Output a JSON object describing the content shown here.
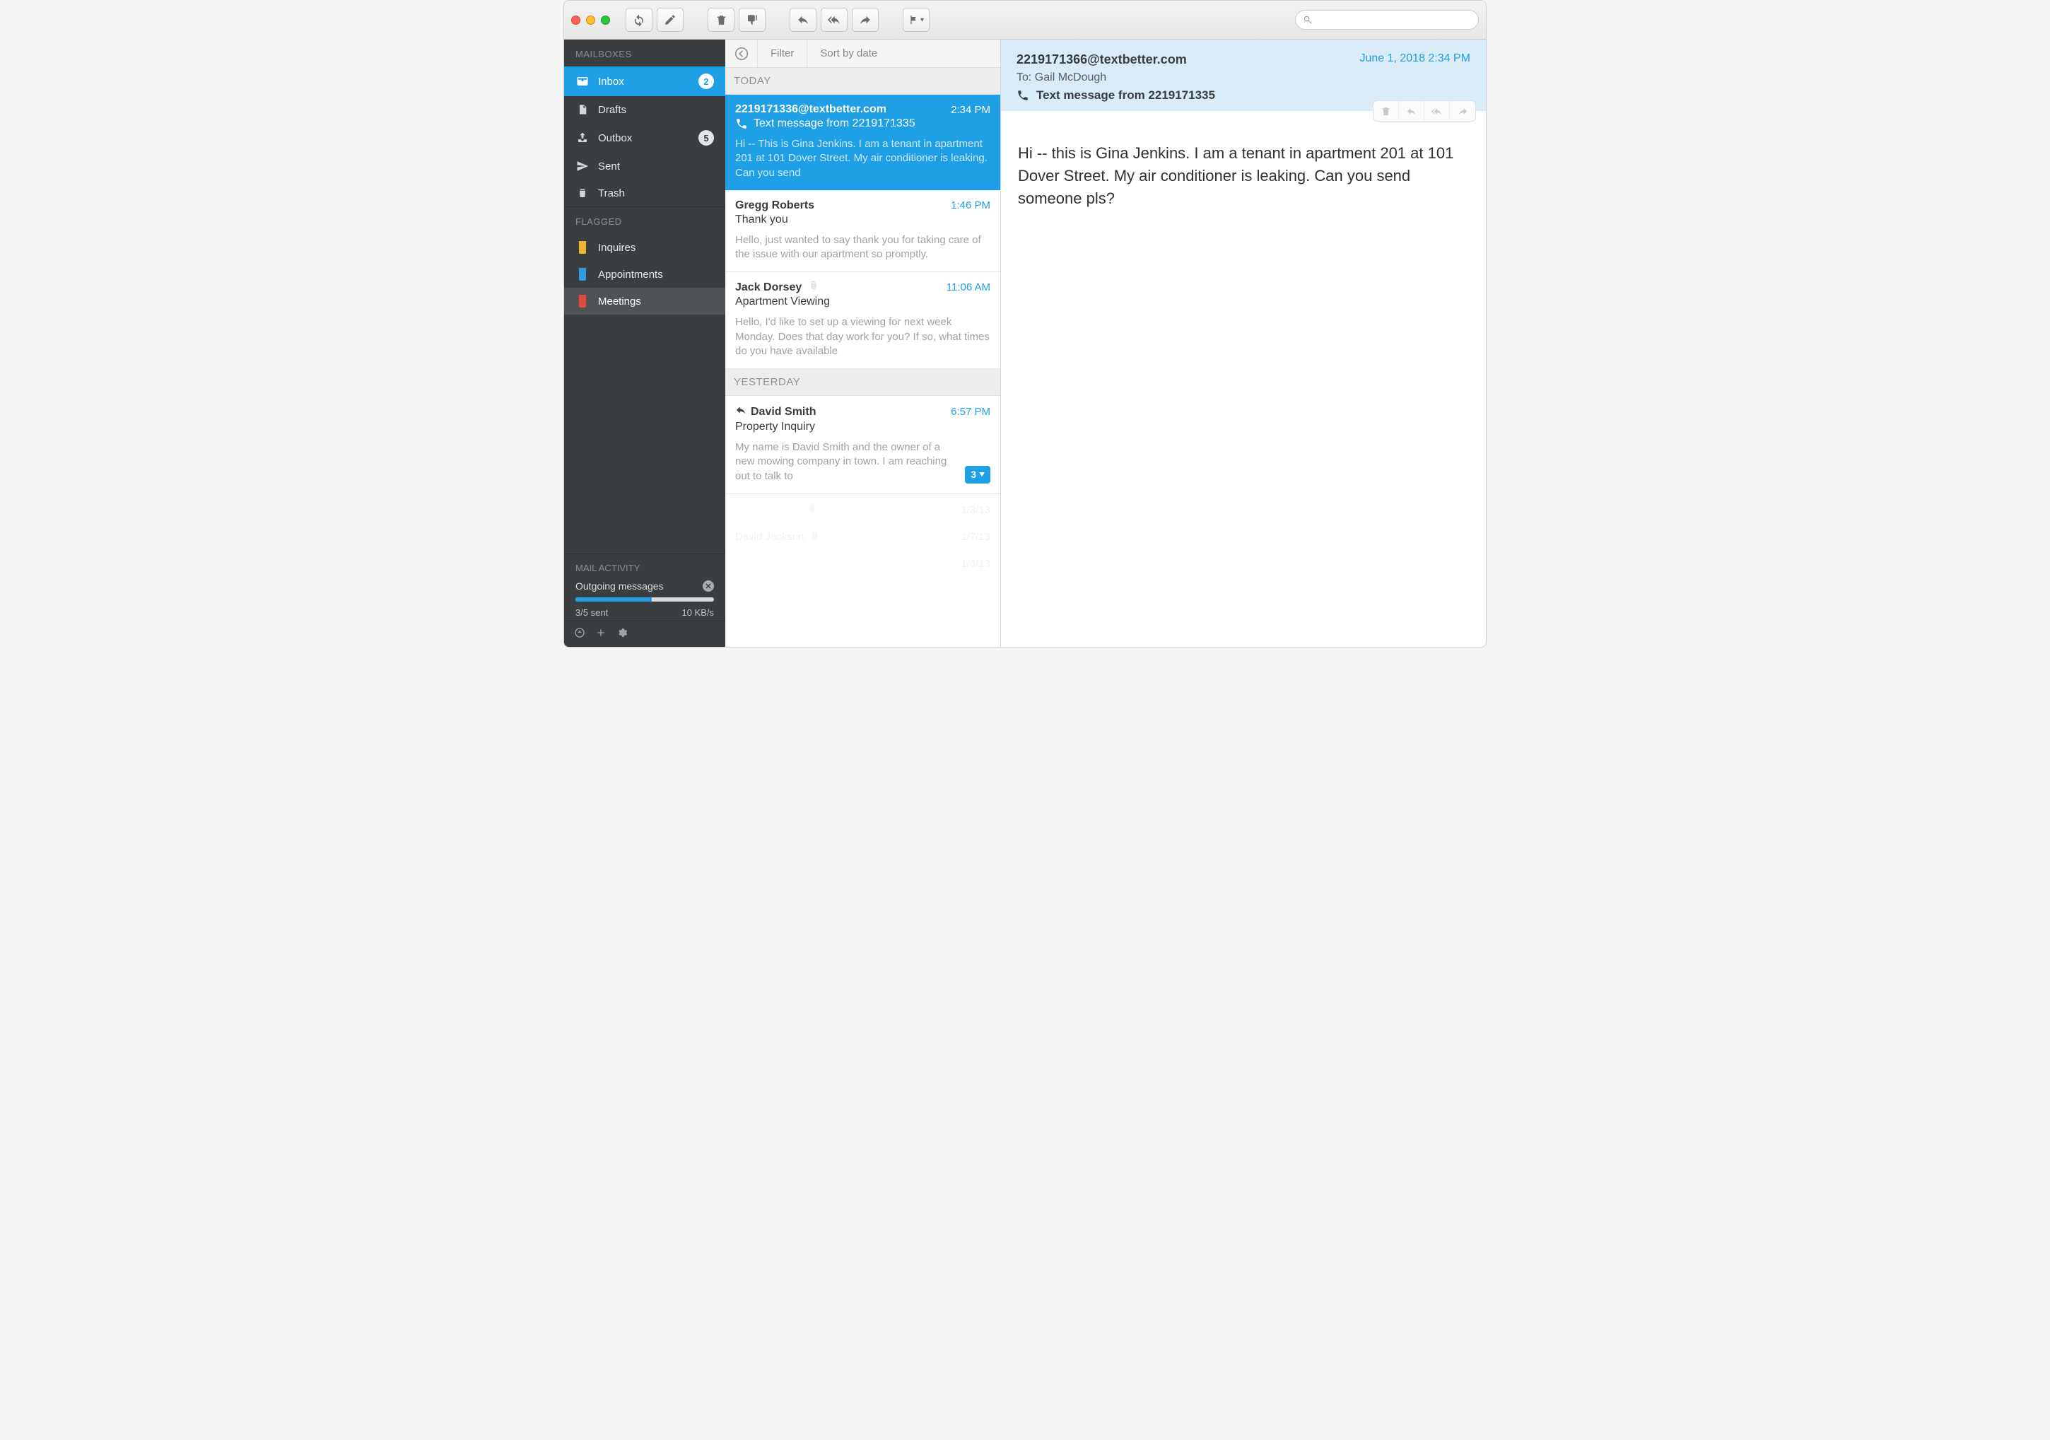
{
  "toolbar": {
    "search_placeholder": ""
  },
  "sidebar": {
    "sections": {
      "mailboxes_label": "MAILBOXES",
      "flagged_label": "FLAGGED",
      "activity_label": "MAIL ACTIVITY"
    },
    "mailboxes": [
      {
        "id": "inbox",
        "label": "Inbox",
        "badge": "2",
        "active": true
      },
      {
        "id": "drafts",
        "label": "Drafts"
      },
      {
        "id": "outbox",
        "label": "Outbox",
        "badge": "5"
      },
      {
        "id": "sent",
        "label": "Sent"
      },
      {
        "id": "trash",
        "label": "Trash"
      }
    ],
    "flagged": [
      {
        "id": "inquires",
        "label": "Inquires",
        "color": "yellow"
      },
      {
        "id": "appointments",
        "label": "Appointments",
        "color": "blue"
      },
      {
        "id": "meetings",
        "label": "Meetings",
        "color": "red",
        "active": true
      }
    ],
    "activity": {
      "outgoing_label": "Outgoing messages",
      "sent_label": "3/5 sent",
      "rate_label": "10 KB/s",
      "progress_pct": 55
    }
  },
  "msglist": {
    "filter_label": "Filter",
    "sort_label": "Sort by date",
    "groups": [
      {
        "header": "TODAY",
        "messages": [
          {
            "sender": "2219171336@textbetter.com",
            "time": "2:34 PM",
            "subject_prefix_icon": "phone",
            "subject": "Text message from 2219171335",
            "preview": "Hi -- This is Gina Jenkins. I am a tenant in apartment 201 at 101 Dover Street. My air conditioner is leaking. Can you send",
            "selected": true
          },
          {
            "sender": "Gregg Roberts",
            "time": "1:46 PM",
            "subject": "Thank you",
            "preview": "Hello, just wanted to say thank you for taking care of the issue with our apartment so promptly."
          },
          {
            "sender": "Jack Dorsey",
            "time": "11:06 AM",
            "subject": "Apartment Viewing",
            "preview": "Hello, I'd like to set up a viewing for next week Monday. Does that day work for you? If so, what times do you have available",
            "attachment": true
          }
        ]
      },
      {
        "header": "YESTERDAY",
        "messages": [
          {
            "sender": "David Smith",
            "time": "6:57 PM",
            "subject": "Property Inquiry",
            "preview": "My name is David Smith and the owner of a new mowing company in town. I am reaching out to talk to",
            "replied": true,
            "thread_count": "3"
          }
        ]
      }
    ],
    "faded": [
      {
        "name": "",
        "date": "1/3/13",
        "attachment": true
      },
      {
        "name": "David Jackson",
        "date": "1/7/13",
        "attachment": true
      },
      {
        "name": "",
        "date": "1/3/13"
      }
    ]
  },
  "reader": {
    "from": "2219171366@textbetter.com",
    "date": "June 1, 2018 2:34 PM",
    "to_prefix": "To: ",
    "to": "Gail McDough",
    "subject": "Text message from 2219171335",
    "body": "Hi -- this is Gina Jenkins. I am a tenant in apartment 201 at 101 Dover Street. My air conditioner is leaking. Can you send someone pls?"
  }
}
